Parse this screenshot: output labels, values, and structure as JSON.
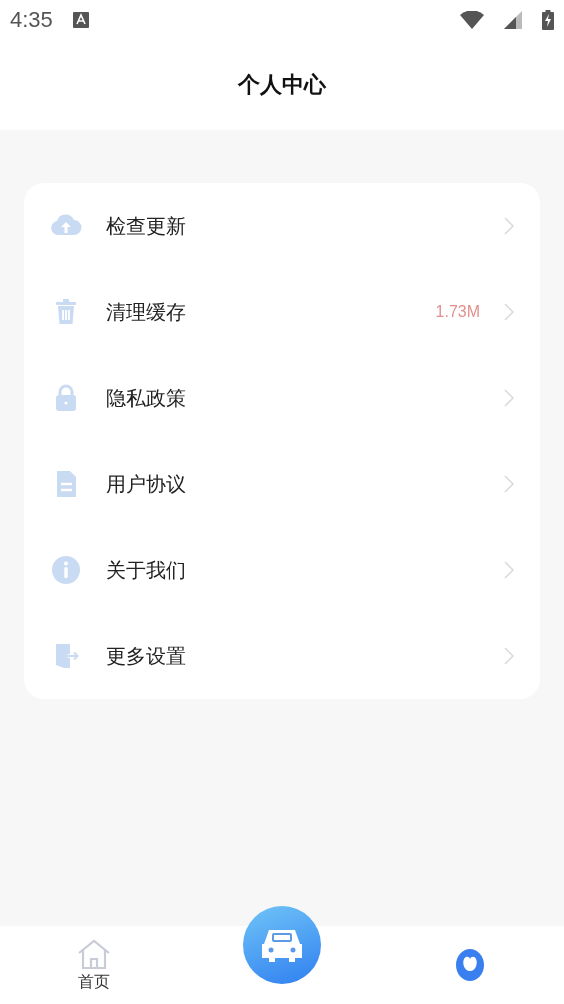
{
  "status_bar": {
    "time": "4:35"
  },
  "header": {
    "title": "个人中心"
  },
  "menu": [
    {
      "kind": "upload",
      "label": "检查更新"
    },
    {
      "kind": "trash",
      "label": "清理缓存",
      "value": "1.73M"
    },
    {
      "kind": "lock",
      "label": "隐私政策"
    },
    {
      "kind": "document",
      "label": "用户协议"
    },
    {
      "kind": "info",
      "label": "关于我们"
    },
    {
      "kind": "exit",
      "label": "更多设置"
    }
  ],
  "bottom_nav": [
    {
      "kind": "home",
      "label": "首页",
      "selected": false
    },
    {
      "kind": "car",
      "selected": false
    },
    {
      "kind": "profile",
      "selected": true
    }
  ]
}
